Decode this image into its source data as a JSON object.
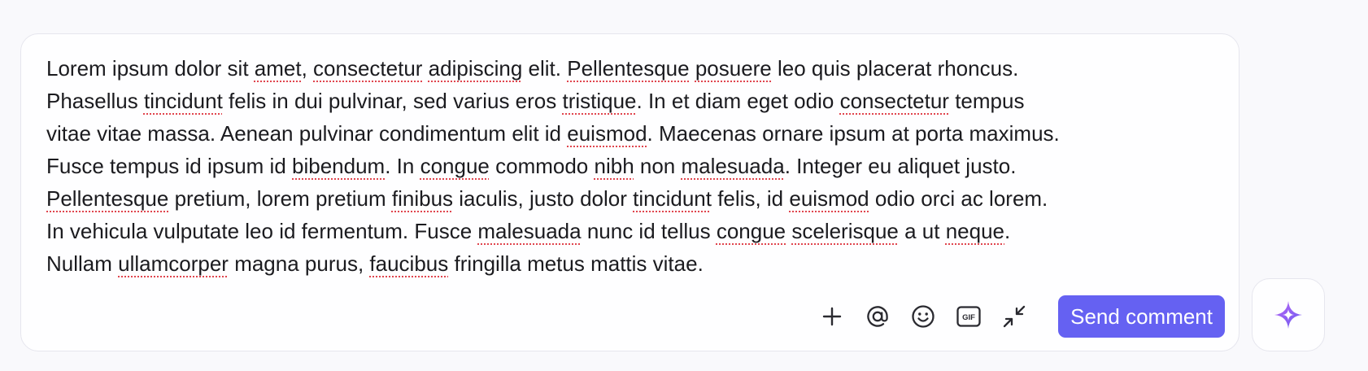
{
  "comment": {
    "lines": [
      [
        {
          "t": "Lorem ipsum dolor sit "
        },
        {
          "t": "amet",
          "s": true
        },
        {
          "t": ", "
        },
        {
          "t": "consectetur",
          "s": true
        },
        {
          "t": " "
        },
        {
          "t": "adipiscing",
          "s": true
        },
        {
          "t": " elit. "
        },
        {
          "t": "Pellentesque",
          "s": true
        },
        {
          "t": " "
        },
        {
          "t": "posuere",
          "s": true
        },
        {
          "t": " leo quis placerat rhoncus."
        }
      ],
      [
        {
          "t": "Phasellus "
        },
        {
          "t": "tincidunt",
          "s": true
        },
        {
          "t": " felis in dui pulvinar, sed varius eros "
        },
        {
          "t": "tristique",
          "s": true
        },
        {
          "t": ". In et diam eget odio "
        },
        {
          "t": "consectetur",
          "s": true
        },
        {
          "t": " tempus"
        }
      ],
      [
        {
          "t": "vitae vitae massa. Aenean pulvinar condimentum elit id "
        },
        {
          "t": "euismod",
          "s": true
        },
        {
          "t": ". Maecenas ornare ipsum at porta maximus."
        }
      ],
      [
        {
          "t": "Fusce tempus id ipsum id "
        },
        {
          "t": "bibendum",
          "s": true
        },
        {
          "t": ". In "
        },
        {
          "t": "congue",
          "s": true
        },
        {
          "t": " commodo "
        },
        {
          "t": "nibh",
          "s": true
        },
        {
          "t": " non "
        },
        {
          "t": "malesuada",
          "s": true
        },
        {
          "t": ". Integer eu aliquet justo."
        }
      ],
      [
        {
          "t": "Pellentesque",
          "s": true
        },
        {
          "t": " pretium, lorem pretium "
        },
        {
          "t": "finibus",
          "s": true
        },
        {
          "t": " iaculis, justo dolor "
        },
        {
          "t": "tincidunt",
          "s": true
        },
        {
          "t": " felis, id "
        },
        {
          "t": "euismod",
          "s": true
        },
        {
          "t": " odio orci ac lorem."
        }
      ],
      [
        {
          "t": "In vehicula vulputate leo id fermentum. Fusce "
        },
        {
          "t": "malesuada",
          "s": true
        },
        {
          "t": " nunc id tellus "
        },
        {
          "t": "congue",
          "s": true
        },
        {
          "t": " "
        },
        {
          "t": "scelerisque",
          "s": true
        },
        {
          "t": " a ut "
        },
        {
          "t": "neque",
          "s": true
        },
        {
          "t": "."
        }
      ],
      [
        {
          "t": "Nullam "
        },
        {
          "t": "ullamcorper",
          "s": true
        },
        {
          "t": " magna purus, "
        },
        {
          "t": "faucibus",
          "s": true
        },
        {
          "t": " fringilla metus mattis vitae."
        }
      ]
    ]
  },
  "toolbar": {
    "icons": {
      "add": "plus-icon",
      "mention": "at-sign-icon",
      "emoji": "smiley-icon",
      "gif": "gif-icon",
      "collapse": "minimize-arrows-icon"
    },
    "gif_label": "GIF",
    "send_label": "Send comment"
  },
  "ai_button": {
    "icon": "sparkle-icon"
  },
  "colors": {
    "accent": "#6561f2",
    "text": "#1b1b1f",
    "spellcheck": "#e0454e",
    "icon": "#2a2a30",
    "sparkle_gradient": [
      "#b764f5",
      "#6a5cf0"
    ]
  }
}
